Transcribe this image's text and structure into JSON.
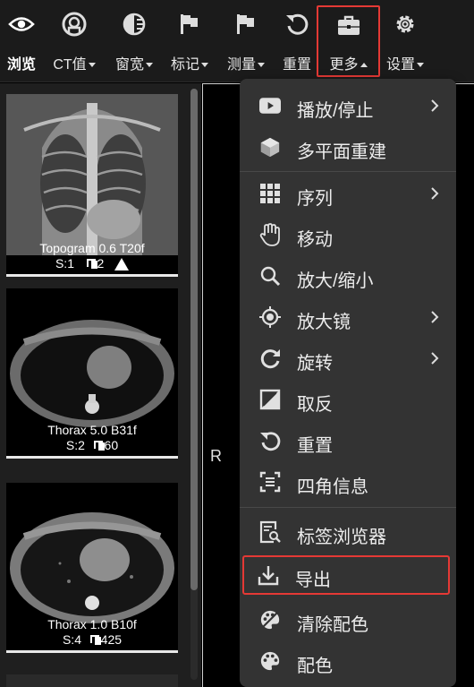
{
  "toolbar": {
    "items": [
      {
        "label": "浏览",
        "icon": "eye-icon"
      },
      {
        "label": "CT值",
        "icon": "ct-value-icon"
      },
      {
        "label": "窗宽",
        "icon": "window-width-icon"
      },
      {
        "label": "标记",
        "icon": "flag-icon"
      },
      {
        "label": "测量",
        "icon": "measure-flag-icon"
      },
      {
        "label": "重置",
        "icon": "reset-icon"
      },
      {
        "label": "更多",
        "icon": "briefcase-icon"
      },
      {
        "label": "设置",
        "icon": "gear-icon"
      }
    ]
  },
  "series": [
    {
      "name": "Topogram 0.6 T20f",
      "number": "S:1",
      "count": "2",
      "warning": true
    },
    {
      "name": "Thorax 5.0 B31f",
      "number": "S:2",
      "count": "60"
    },
    {
      "name": "Thorax 1.0 B10f",
      "number": "S:4",
      "count": "425"
    }
  ],
  "viewport": {
    "orientation": "R"
  },
  "menu": {
    "items": [
      {
        "label": "播放/停止",
        "icon": "play-icon",
        "submenu": true
      },
      {
        "label": "多平面重建",
        "icon": "cube-icon"
      },
      {
        "label": "序列",
        "icon": "grid-icon",
        "submenu": true
      },
      {
        "label": "移动",
        "icon": "hand-icon"
      },
      {
        "label": "放大/缩小",
        "icon": "magnifier-icon"
      },
      {
        "label": "放大镜",
        "icon": "target-icon",
        "submenu": true
      },
      {
        "label": "旋转",
        "icon": "rotate-icon",
        "submenu": true
      },
      {
        "label": "取反",
        "icon": "invert-icon"
      },
      {
        "label": "重置",
        "icon": "reset-icon"
      },
      {
        "label": "四角信息",
        "icon": "corner-info-icon"
      },
      {
        "label": "标签浏览器",
        "icon": "tag-browser-icon"
      },
      {
        "label": "导出",
        "icon": "download-icon"
      },
      {
        "label": "清除配色",
        "icon": "palette-clear-icon"
      },
      {
        "label": "配色",
        "icon": "palette-icon"
      }
    ]
  },
  "colors": {
    "highlight": "#e53935",
    "menu_bg": "#333333",
    "toolbar_bg": "#1b1b1b"
  }
}
